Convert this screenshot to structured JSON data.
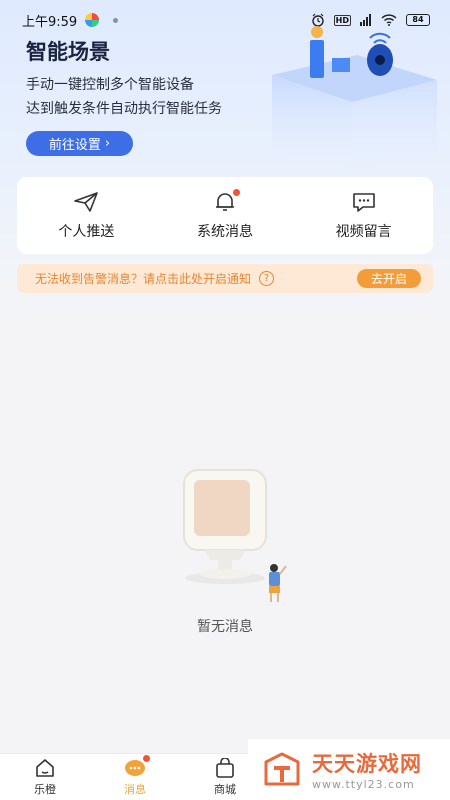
{
  "status_bar": {
    "time": "上午9:59",
    "hd": "HD",
    "battery": "84"
  },
  "hero": {
    "title": "智能场景",
    "line1": "手动一键控制多个智能设备",
    "line2": "达到触发条件自动执行智能任务",
    "button_label": "前往设置",
    "button_arrow": "›"
  },
  "functions": [
    {
      "label": "个人推送",
      "icon": "paper-plane-icon",
      "badge": false
    },
    {
      "label": "系统消息",
      "icon": "bell-icon",
      "badge": true
    },
    {
      "label": "视频留言",
      "icon": "chat-bubble-icon",
      "badge": false
    }
  ],
  "alert": {
    "text": "无法收到告警消息？请点击此处开启通知",
    "help": "?",
    "button_label": "去开启"
  },
  "empty_state": {
    "text": "暂无消息"
  },
  "tabbar": [
    {
      "label": "乐橙",
      "icon": "home-icon",
      "active": false
    },
    {
      "label": "消息",
      "icon": "message-icon",
      "active": true,
      "badge": true
    },
    {
      "label": "商城",
      "icon": "shopping-bag-icon",
      "active": false
    }
  ],
  "watermark": {
    "title": "天天游戏网",
    "url": "www.ttyl23.com"
  },
  "colors": {
    "accent_blue": "#3d6ee6",
    "orange": "#f39c3a",
    "badge_red": "#f0543a"
  }
}
